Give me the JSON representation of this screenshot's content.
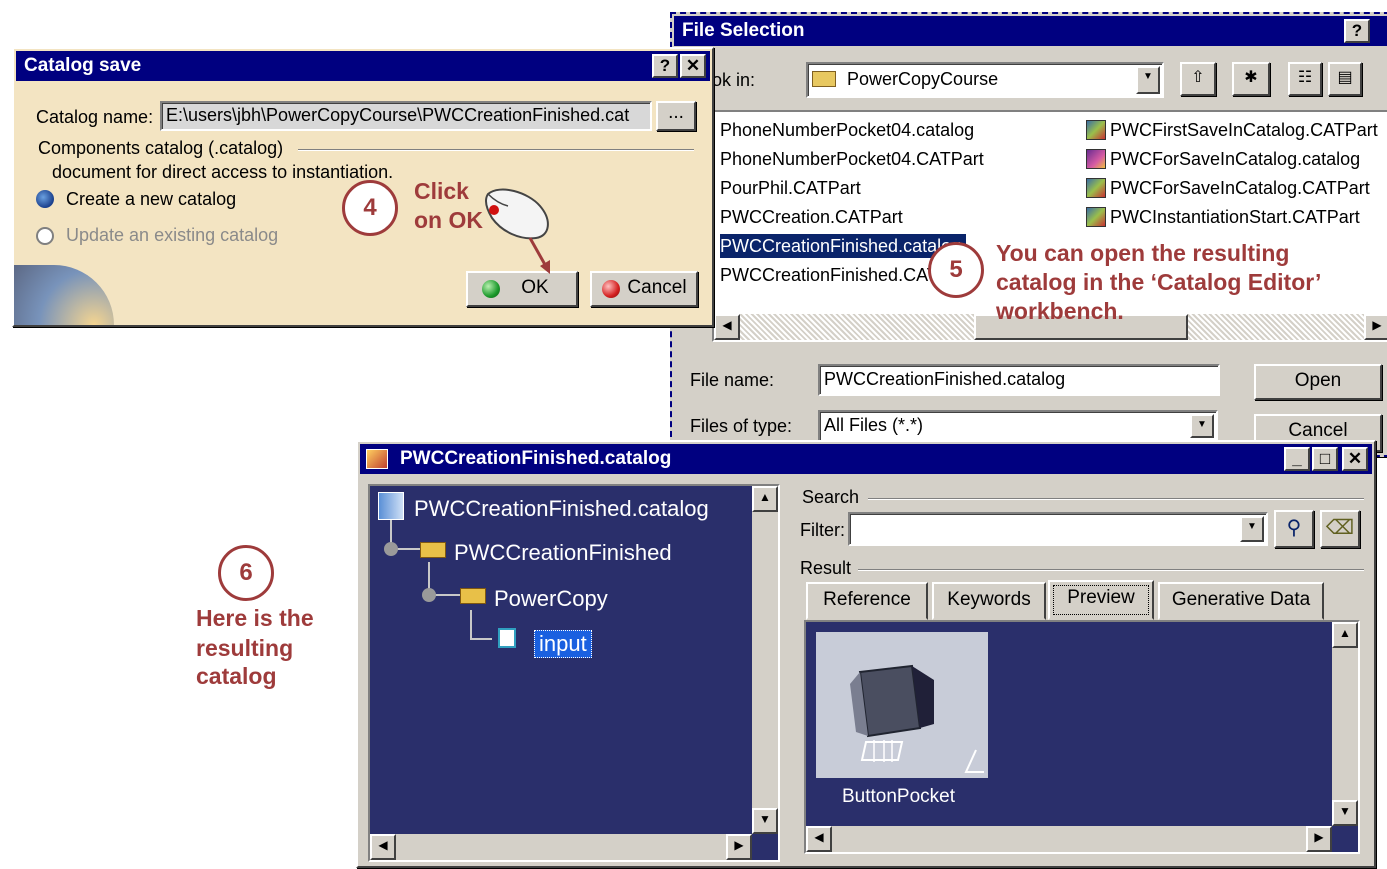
{
  "catalog_save": {
    "title": "Catalog save",
    "help_btn": "?",
    "close_btn": "✕",
    "catalog_name_label": "Catalog name:",
    "catalog_name_value": "E:\\users\\jbh\\PowerCopyCourse\\PWCCreationFinished.cat",
    "browse_btn": "...",
    "components_label": "Components catalog (.catalog)",
    "description": "document for direct access to instantiation.",
    "create_option": "Create a new catalog",
    "update_option": "Update an existing catalog",
    "ok_btn": "OK",
    "cancel_btn": "Cancel"
  },
  "file_selection": {
    "title": "File Selection",
    "help_btn": "?",
    "look_in_label": "ok in:",
    "look_in_value": "PowerCopyCourse",
    "files_left": [
      "PhoneNumberPocket04.catalog",
      "PhoneNumberPocket04.CATPart",
      "PourPhil.CATPart",
      "PWCCreation.CATPart",
      "PWCCreationFinished.catalog",
      "PWCCreationFinished.CATPart"
    ],
    "files_right": [
      "PWCFirstSaveInCatalog.CATPart",
      "PWCForSaveInCatalog.catalog",
      "PWCForSaveInCatalog.CATPart",
      "PWCInstantiationStart.CATPart"
    ],
    "file_name_label": "File name:",
    "file_name_value": "PWCCreationFinished.catalog",
    "files_of_type_label": "Files of type:",
    "files_of_type_value": "All Files (*.*)",
    "open_btn": "Open",
    "cancel_btn": "Cancel"
  },
  "catalog_editor": {
    "title": "PWCCreationFinished.catalog",
    "tree": {
      "root": "PWCCreationFinished.catalog",
      "chapter": "PWCCreationFinished",
      "family": "PowerCopy",
      "item": "input"
    },
    "search_label": "Search",
    "filter_label": "Filter:",
    "filter_value": "",
    "result_label": "Result",
    "tabs": [
      "Reference",
      "Keywords",
      "Preview",
      "Generative Data"
    ],
    "active_tab": "Preview",
    "preview_caption": "ButtonPocket"
  },
  "annotations": {
    "step4_number": "4",
    "step4_text_line1": "Click",
    "step4_text_line2": "on OK",
    "step5_number": "5",
    "step5_text_line1": "You can open the resulting",
    "step5_text_line2": "catalog in the ‘Catalog Editor’",
    "step5_text_line3": "workbench.",
    "step6_number": "6",
    "step6_text_line1": "Here is the",
    "step6_text_line2": "resulting",
    "step6_text_line3": "catalog"
  },
  "colors": {
    "title_bar": "#000080",
    "dialog_face": "#d4d0c8",
    "catalog_save_face": "#f3e4c2",
    "tree_background": "#2a2f6b",
    "annotation": "#9e3b3b",
    "selection": "#0a246a"
  }
}
